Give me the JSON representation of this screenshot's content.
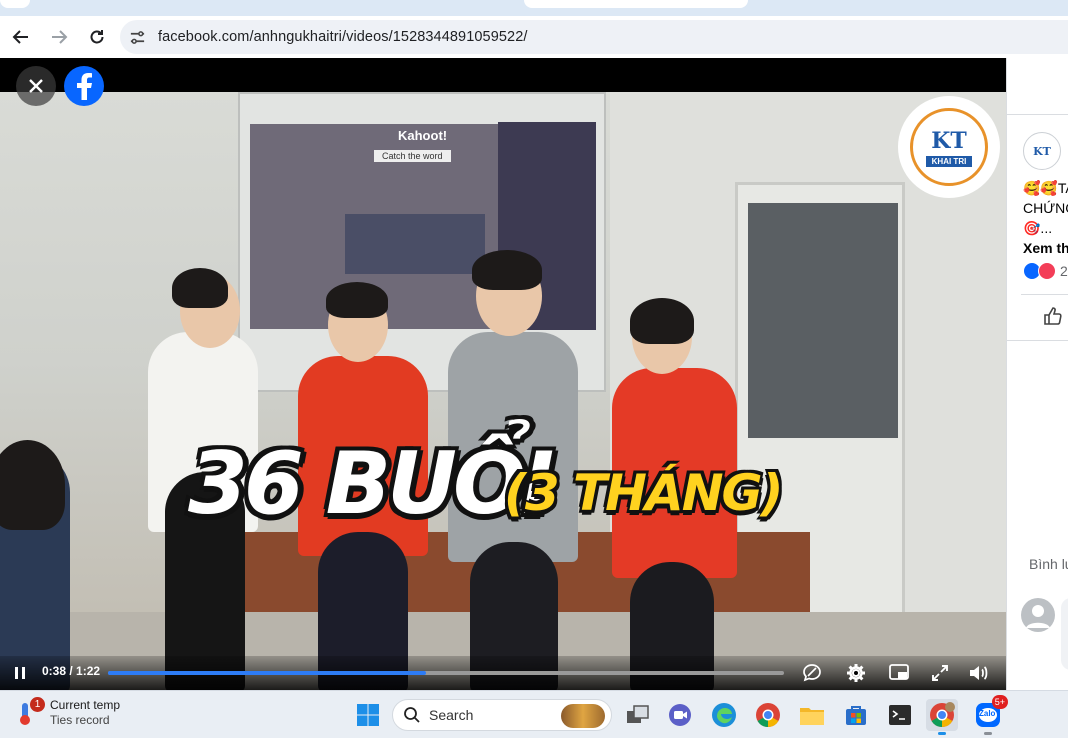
{
  "browser": {
    "url": "facebook.com/anhngukhaitri/videos/1528344891059522/"
  },
  "video": {
    "overlay_title": "36 BUỔI",
    "overlay_subtitle": "(3 THÁNG)",
    "screen_text_1": "Kahoot!",
    "screen_text_2": "Catch the word",
    "logo_text": "KT",
    "logo_sub": "KHAI TRI",
    "time_display": "0:38 / 1:22",
    "progress": 0.47
  },
  "side_panel": {
    "post_line_1": "🥰🥰TA",
    "post_line_2": "CHỨNG",
    "post_line_3": "🎯...",
    "see_more": "Xem th",
    "reaction_count": "2",
    "comments_label": "Bình lu"
  },
  "taskbar": {
    "weather_badge": "1",
    "weather_title": "Current temp",
    "weather_sub": "Ties record",
    "search_placeholder": "Search",
    "zalo_badge": "5+",
    "zalo_label": "Zalo"
  },
  "colors": {
    "facebook_blue": "#0866ff",
    "progress_blue": "#2d7cf6",
    "overlay_yellow": "#ffd21f"
  }
}
